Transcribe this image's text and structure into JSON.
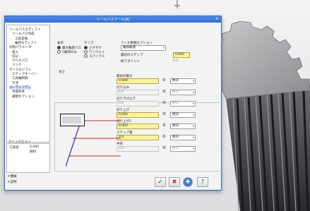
{
  "window": {
    "title": "ツールバスツール(R)"
  },
  "tree": {
    "items": [
      {
        "label": "ツールパスモディファ",
        "indent": 0
      },
      {
        "label": "ツールパス作成",
        "indent": 1
      },
      {
        "label": "工具変換",
        "indent": 2
      },
      {
        "label": "輪郭モディファ",
        "indent": 2
      },
      {
        "label": "切削パラメータ",
        "indent": 0
      },
      {
        "label": "進入",
        "indent": 1
      },
      {
        "label": "切込",
        "indent": 1
      },
      {
        "label": "マルチパス",
        "indent": 1
      },
      {
        "label": "リンク",
        "indent": 1
      },
      {
        "label": "マイクロリフト",
        "indent": 0
      },
      {
        "label": "ステップオーバー",
        "indent": 1
      },
      {
        "label": "工具軸制御",
        "indent": 1
      },
      {
        "label": "干渉",
        "indent": 1
      },
      {
        "label": "ユーティリティ",
        "indent": 0,
        "selected": true
      },
      {
        "label": "手順条件",
        "indent": 1
      },
      {
        "label": "補間オプション",
        "indent": 1
      }
    ]
  },
  "quicklist": {
    "header": "クイックビュー",
    "rows": [
      {
        "c1": "工具径",
        "c2": "0.000"
      },
      {
        "c1": "",
        "c2": "鋼材"
      }
    ]
  },
  "left_bottom": {
    "a": "＊機械",
    "b": "＊説明"
  },
  "sections": {
    "s1": {
      "title": "表示",
      "opt1": "最大輪郭パス",
      "opt2": "1輪郭のみ"
    },
    "s2": {
      "title": "タイプ",
      "opt1": "ジグザグ",
      "opt2": "ワンウェイ",
      "opt3": "スパイラル"
    },
    "s3": {
      "title": "ツール制御オプション",
      "dd": "輪郭最適",
      "label_a": "最初のステップ",
      "value_a": "0.000",
      "label_b": "終了ポイント",
      "value_b": "0.0"
    }
  },
  "panel": {
    "title": "深さ",
    "rows": [
      {
        "label": "最初の最大",
        "value": "0.000",
        "active": true,
        "dd": "絶対"
      },
      {
        "label": "切り込み",
        "value": "0.0",
        "active": false,
        "dd": "絶対"
      },
      {
        "label": "切り下げ以下",
        "value": "0.0",
        "active": false,
        "dd": "絶対"
      },
      {
        "label": "切り上げ",
        "value": "0.000",
        "active": true,
        "dd": "絶対"
      },
      {
        "label": "切り上げ2",
        "value": "0.000",
        "active": true,
        "dd": "絶対"
      },
      {
        "label": "ステップ量",
        "value": "0.0",
        "active": true,
        "dd": "絶対"
      },
      {
        "label": "中央",
        "value": "0.0",
        "active": false,
        "dd": "絶対"
      }
    ]
  },
  "buttons": {
    "ok": "✔",
    "cancel": "✖",
    "apply": "✚",
    "help": "?"
  },
  "colors": {
    "titlebar": "#2f6fd8",
    "highlight_field": "#fdf39b",
    "line_blue": "#4a3fbf",
    "line_red": "#e0202a"
  }
}
